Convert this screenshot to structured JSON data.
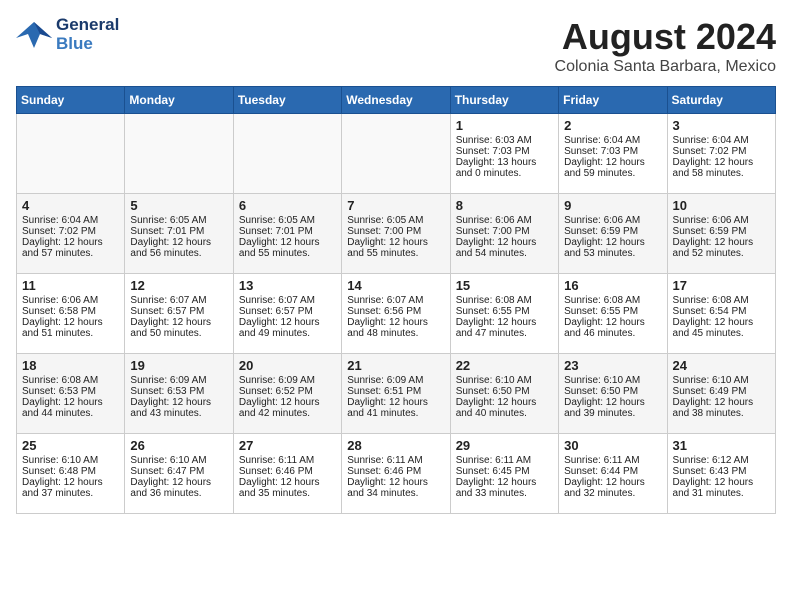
{
  "header": {
    "logo_line1": "General",
    "logo_line2": "Blue",
    "main_title": "August 2024",
    "subtitle": "Colonia Santa Barbara, Mexico"
  },
  "days_of_week": [
    "Sunday",
    "Monday",
    "Tuesday",
    "Wednesday",
    "Thursday",
    "Friday",
    "Saturday"
  ],
  "weeks": [
    [
      {
        "day": "",
        "info": ""
      },
      {
        "day": "",
        "info": ""
      },
      {
        "day": "",
        "info": ""
      },
      {
        "day": "",
        "info": ""
      },
      {
        "day": "1",
        "info": "Sunrise: 6:03 AM\nSunset: 7:03 PM\nDaylight: 13 hours\nand 0 minutes."
      },
      {
        "day": "2",
        "info": "Sunrise: 6:04 AM\nSunset: 7:03 PM\nDaylight: 12 hours\nand 59 minutes."
      },
      {
        "day": "3",
        "info": "Sunrise: 6:04 AM\nSunset: 7:02 PM\nDaylight: 12 hours\nand 58 minutes."
      }
    ],
    [
      {
        "day": "4",
        "info": "Sunrise: 6:04 AM\nSunset: 7:02 PM\nDaylight: 12 hours\nand 57 minutes."
      },
      {
        "day": "5",
        "info": "Sunrise: 6:05 AM\nSunset: 7:01 PM\nDaylight: 12 hours\nand 56 minutes."
      },
      {
        "day": "6",
        "info": "Sunrise: 6:05 AM\nSunset: 7:01 PM\nDaylight: 12 hours\nand 55 minutes."
      },
      {
        "day": "7",
        "info": "Sunrise: 6:05 AM\nSunset: 7:00 PM\nDaylight: 12 hours\nand 55 minutes."
      },
      {
        "day": "8",
        "info": "Sunrise: 6:06 AM\nSunset: 7:00 PM\nDaylight: 12 hours\nand 54 minutes."
      },
      {
        "day": "9",
        "info": "Sunrise: 6:06 AM\nSunset: 6:59 PM\nDaylight: 12 hours\nand 53 minutes."
      },
      {
        "day": "10",
        "info": "Sunrise: 6:06 AM\nSunset: 6:59 PM\nDaylight: 12 hours\nand 52 minutes."
      }
    ],
    [
      {
        "day": "11",
        "info": "Sunrise: 6:06 AM\nSunset: 6:58 PM\nDaylight: 12 hours\nand 51 minutes."
      },
      {
        "day": "12",
        "info": "Sunrise: 6:07 AM\nSunset: 6:57 PM\nDaylight: 12 hours\nand 50 minutes."
      },
      {
        "day": "13",
        "info": "Sunrise: 6:07 AM\nSunset: 6:57 PM\nDaylight: 12 hours\nand 49 minutes."
      },
      {
        "day": "14",
        "info": "Sunrise: 6:07 AM\nSunset: 6:56 PM\nDaylight: 12 hours\nand 48 minutes."
      },
      {
        "day": "15",
        "info": "Sunrise: 6:08 AM\nSunset: 6:55 PM\nDaylight: 12 hours\nand 47 minutes."
      },
      {
        "day": "16",
        "info": "Sunrise: 6:08 AM\nSunset: 6:55 PM\nDaylight: 12 hours\nand 46 minutes."
      },
      {
        "day": "17",
        "info": "Sunrise: 6:08 AM\nSunset: 6:54 PM\nDaylight: 12 hours\nand 45 minutes."
      }
    ],
    [
      {
        "day": "18",
        "info": "Sunrise: 6:08 AM\nSunset: 6:53 PM\nDaylight: 12 hours\nand 44 minutes."
      },
      {
        "day": "19",
        "info": "Sunrise: 6:09 AM\nSunset: 6:53 PM\nDaylight: 12 hours\nand 43 minutes."
      },
      {
        "day": "20",
        "info": "Sunrise: 6:09 AM\nSunset: 6:52 PM\nDaylight: 12 hours\nand 42 minutes."
      },
      {
        "day": "21",
        "info": "Sunrise: 6:09 AM\nSunset: 6:51 PM\nDaylight: 12 hours\nand 41 minutes."
      },
      {
        "day": "22",
        "info": "Sunrise: 6:10 AM\nSunset: 6:50 PM\nDaylight: 12 hours\nand 40 minutes."
      },
      {
        "day": "23",
        "info": "Sunrise: 6:10 AM\nSunset: 6:50 PM\nDaylight: 12 hours\nand 39 minutes."
      },
      {
        "day": "24",
        "info": "Sunrise: 6:10 AM\nSunset: 6:49 PM\nDaylight: 12 hours\nand 38 minutes."
      }
    ],
    [
      {
        "day": "25",
        "info": "Sunrise: 6:10 AM\nSunset: 6:48 PM\nDaylight: 12 hours\nand 37 minutes."
      },
      {
        "day": "26",
        "info": "Sunrise: 6:10 AM\nSunset: 6:47 PM\nDaylight: 12 hours\nand 36 minutes."
      },
      {
        "day": "27",
        "info": "Sunrise: 6:11 AM\nSunset: 6:46 PM\nDaylight: 12 hours\nand 35 minutes."
      },
      {
        "day": "28",
        "info": "Sunrise: 6:11 AM\nSunset: 6:46 PM\nDaylight: 12 hours\nand 34 minutes."
      },
      {
        "day": "29",
        "info": "Sunrise: 6:11 AM\nSunset: 6:45 PM\nDaylight: 12 hours\nand 33 minutes."
      },
      {
        "day": "30",
        "info": "Sunrise: 6:11 AM\nSunset: 6:44 PM\nDaylight: 12 hours\nand 32 minutes."
      },
      {
        "day": "31",
        "info": "Sunrise: 6:12 AM\nSunset: 6:43 PM\nDaylight: 12 hours\nand 31 minutes."
      }
    ]
  ]
}
